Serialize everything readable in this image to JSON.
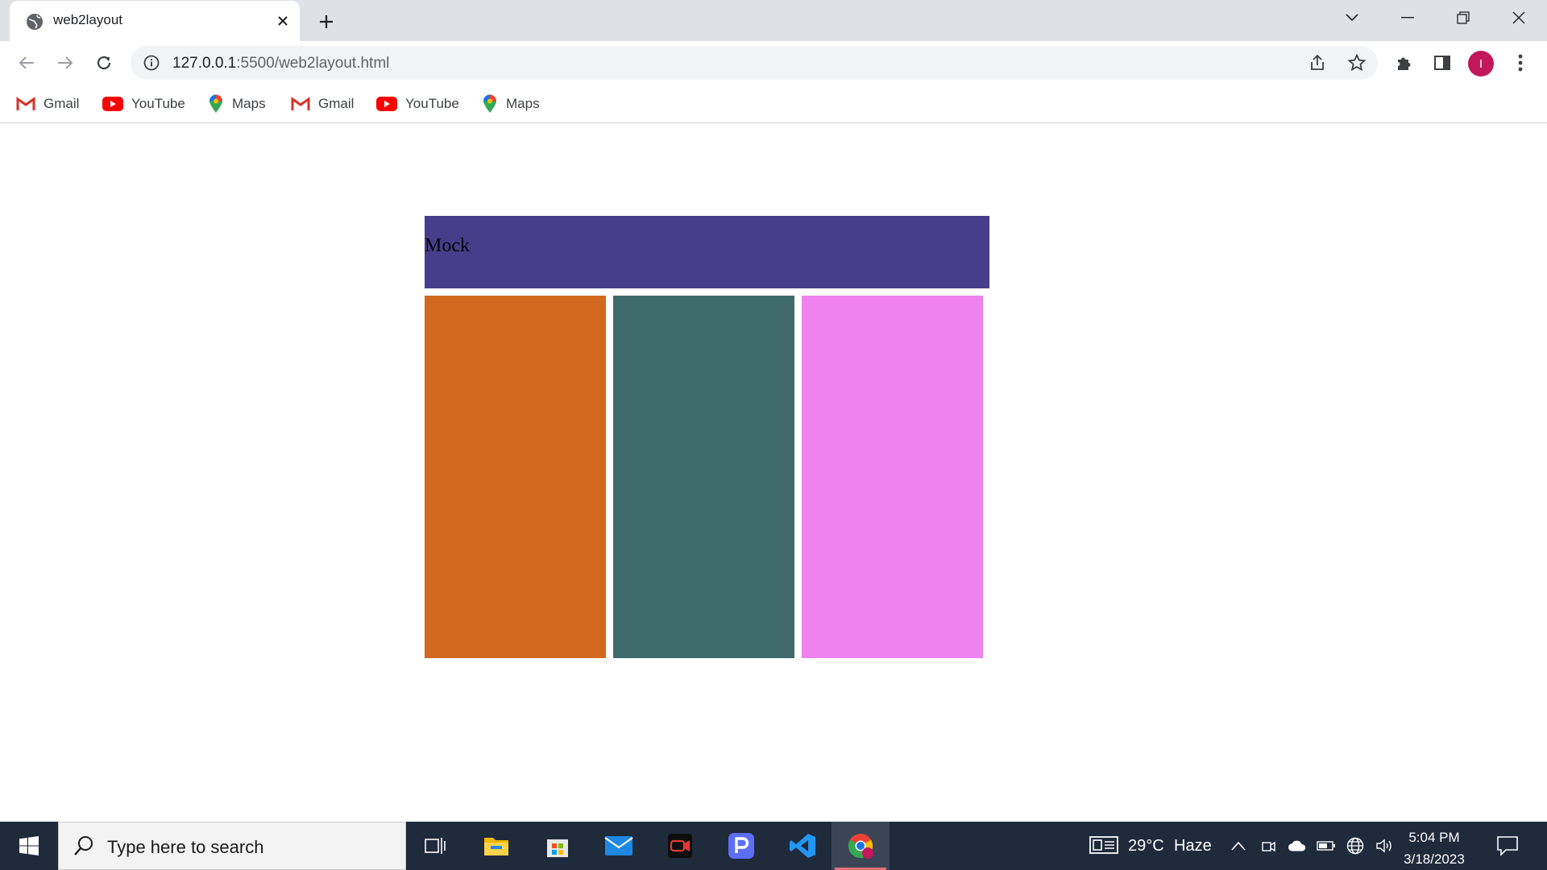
{
  "browser": {
    "tab": {
      "title": "web2layout"
    },
    "url": {
      "host": "127.0.0.1",
      "rest": ":5500/web2layout.html"
    },
    "profile_initial": "I",
    "bookmarks": [
      "Gmail",
      "YouTube",
      "Maps",
      "Gmail",
      "YouTube",
      "Maps"
    ]
  },
  "page": {
    "header_text": "Mock",
    "colors": {
      "header": "#483d8b",
      "column_1": "#d2691e",
      "column_2": "#3e6b69",
      "column_3": "#ee82ee"
    }
  },
  "taskbar": {
    "search_placeholder": "Type here to search",
    "weather": {
      "temp": "29°C",
      "condition": "Haze"
    },
    "time": "5:04 PM",
    "date": "3/18/2023",
    "apps": [
      "task-view",
      "file-explorer",
      "microsoft-store",
      "mail",
      "screen-recorder",
      "pin-app",
      "vs-code",
      "chrome"
    ]
  }
}
